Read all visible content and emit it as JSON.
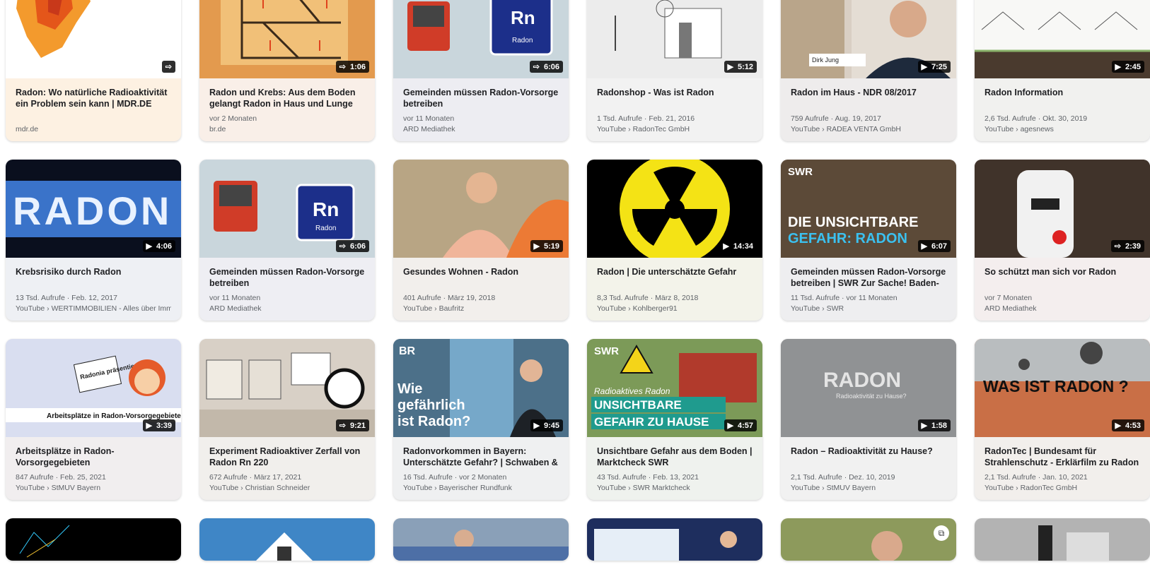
{
  "rows": [
    [
      {
        "title": "Radon: Wo natürliche Radioaktivität ein Problem sein kann | MDR.DE",
        "meta": "",
        "source": "mdr.de",
        "duration": "",
        "icon": "share-icon",
        "bg": "#fdf0e0"
      },
      {
        "title": "Radon und Krebs: Aus dem Boden gelangt Radon in Haus und Lunge",
        "meta": "vor 2 Monaten",
        "source": "br.de",
        "duration": "1:06",
        "icon": "share-icon",
        "bg": "#f9eee6"
      },
      {
        "title": "Gemeinden müssen Radon-Vorsorge betreiben",
        "meta": "vor 11 Monaten",
        "source": "ARD Mediathek",
        "duration": "6:06",
        "icon": "share-icon",
        "bg": "#eeeef2"
      },
      {
        "title": "Radonshop - Was ist Radon",
        "meta": "1 Tsd. Aufrufe · Feb. 21, 2016",
        "source": "YouTube › RadonTec GmbH",
        "duration": "5:12",
        "icon": "play-icon",
        "bg": "#f2f2f2"
      },
      {
        "title": "Radon im Haus - NDR 08/2017",
        "meta": "759 Aufrufe · Aug. 19, 2017",
        "source": "YouTube › RADEA VENTA GmbH",
        "duration": "7:25",
        "icon": "play-icon",
        "bg": "#eeecec"
      },
      {
        "title": "Radon Information",
        "meta": "2,6 Tsd. Aufrufe · Okt. 30, 2019",
        "source": "YouTube › agesnews",
        "duration": "2:45",
        "icon": "play-icon",
        "bg": "#f1f1ef"
      }
    ],
    [
      {
        "title": "Krebsrisiko durch Radon",
        "meta": "13 Tsd. Aufrufe · Feb. 12, 2017",
        "source": "YouTube › WERTIMMOBILIEN - Alles über Immobi...",
        "duration": "4:06",
        "icon": "play-icon",
        "bg": "#eef0f4"
      },
      {
        "title": "Gemeinden müssen Radon-Vorsorge betreiben",
        "meta": "vor 11 Monaten",
        "source": "ARD Mediathek",
        "duration": "6:06",
        "icon": "share-icon",
        "bg": "#eeeef3"
      },
      {
        "title": "Gesundes Wohnen - Radon",
        "meta": "401 Aufrufe · März 19, 2018",
        "source": "YouTube › Baufritz",
        "duration": "5:19",
        "icon": "play-icon",
        "bg": "#f2efec"
      },
      {
        "title": "Radon | Die unterschätzte Gefahr",
        "meta": "8,3 Tsd. Aufrufe · März 8, 2018",
        "source": "YouTube › Kohlberger91",
        "duration": "14:34",
        "icon": "play-icon",
        "bg": "#f3f3ea"
      },
      {
        "title": "Gemeinden müssen Radon-Vorsorge betreiben | SWR Zur Sache! Baden-W...",
        "meta": "11 Tsd. Aufrufe · vor 11 Monaten",
        "source": "YouTube › SWR",
        "duration": "6:07",
        "icon": "play-icon",
        "bg": "#eeeef0"
      },
      {
        "title": "So schützt man sich vor Radon",
        "meta": "vor 7 Monaten",
        "source": "ARD Mediathek",
        "duration": "2:39",
        "icon": "share-icon",
        "bg": "#f4eeee"
      }
    ],
    [
      {
        "title": "Arbeitsplätze in Radon-Vorsorgegebieten",
        "meta": "847 Aufrufe · Feb. 25, 2021",
        "source": "YouTube › StMUV Bayern",
        "duration": "3:39",
        "icon": "play-icon",
        "bg": "#f1eeef"
      },
      {
        "title": "Experiment Radioaktiver Zerfall von Radon Rn 220",
        "meta": "672 Aufrufe · März 17, 2021",
        "source": "YouTube › Christian Schneider",
        "duration": "9:21",
        "icon": "share-icon",
        "bg": "#f1efec"
      },
      {
        "title": "Radonvorkommen in Bayern: Unterschätzte Gefahr? | Schwaben & ...",
        "meta": "16 Tsd. Aufrufe · vor 2 Monaten",
        "source": "YouTube › Bayerischer Rundfunk",
        "duration": "9:45",
        "icon": "play-icon",
        "bg": "#eff0f1"
      },
      {
        "title": "Unsichtbare Gefahr aus dem Boden | Marktcheck SWR",
        "meta": "43 Tsd. Aufrufe · Feb. 13, 2021",
        "source": "YouTube › SWR Marktcheck",
        "duration": "4:57",
        "icon": "play-icon",
        "bg": "#eff2ee"
      },
      {
        "title": "Radon – Radioaktivität zu Hause?",
        "meta": "2,1 Tsd. Aufrufe · Dez. 10, 2019",
        "source": "YouTube › StMUV Bayern",
        "duration": "1:58",
        "icon": "play-icon",
        "bg": "#f1f1f1"
      },
      {
        "title": "RadonTec | Bundesamt für Strahlenschutz - Erklärfilm zu Radon",
        "meta": "2,1 Tsd. Aufrufe · Jan. 10, 2021",
        "source": "YouTube › RadonTec GmbH",
        "duration": "4:53",
        "icon": "play-icon",
        "bg": "#f2efec"
      }
    ]
  ],
  "thumb_text": {
    "rn_symbol": "Rn",
    "rn_name": "Radon",
    "radon_logo": "RADON",
    "swr": "SWR",
    "br": "BR",
    "unsichtbare": "DIE UNSICHTBARE",
    "gefahr_radon": "GEFAHR: RADON",
    "wie": "Wie gefährlich ist Radon?",
    "aktives": "Radioaktives Radon",
    "unsichtbare2": "UNSICHTBARE",
    "gefahr_hause": "GEFAHR ZU HAUSE",
    "radioakt_hause": "Radioaktivität zu Hause?",
    "was_ist": "WAS IST RADON ?",
    "radonia": "Radonia präsentiert:",
    "arbeits_overlay": "Arbeitsplätze in Radon-Vorsorgegebieten",
    "dirk": "Dirk Jung"
  }
}
